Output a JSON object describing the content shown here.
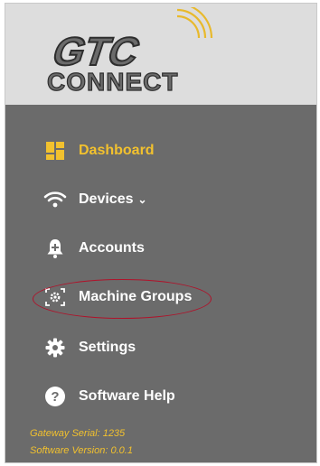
{
  "brand": {
    "logo_top": "GTC",
    "logo_bottom": "CONNECT"
  },
  "nav": {
    "items": [
      {
        "label": "Dashboard",
        "icon": "dashboard-icon",
        "active": true
      },
      {
        "label": "Devices",
        "icon": "wifi-icon",
        "has_chevron": true
      },
      {
        "label": "Accounts",
        "icon": "bell-plus-icon"
      },
      {
        "label": "Machine Groups",
        "icon": "machine-groups-icon"
      },
      {
        "label": "Settings",
        "icon": "gear-icon"
      },
      {
        "label": "Software Help",
        "icon": "help-icon"
      }
    ],
    "chevron": "⌄"
  },
  "footer": {
    "gateway_serial": "Gateway Serial: 1235",
    "software_version": "Software Version: 0.0.1"
  },
  "colors": {
    "sidebar_bg": "#6b6b6b",
    "header_bg": "#dddddd",
    "accent": "#f2c12e",
    "annotation": "#b0122a"
  }
}
